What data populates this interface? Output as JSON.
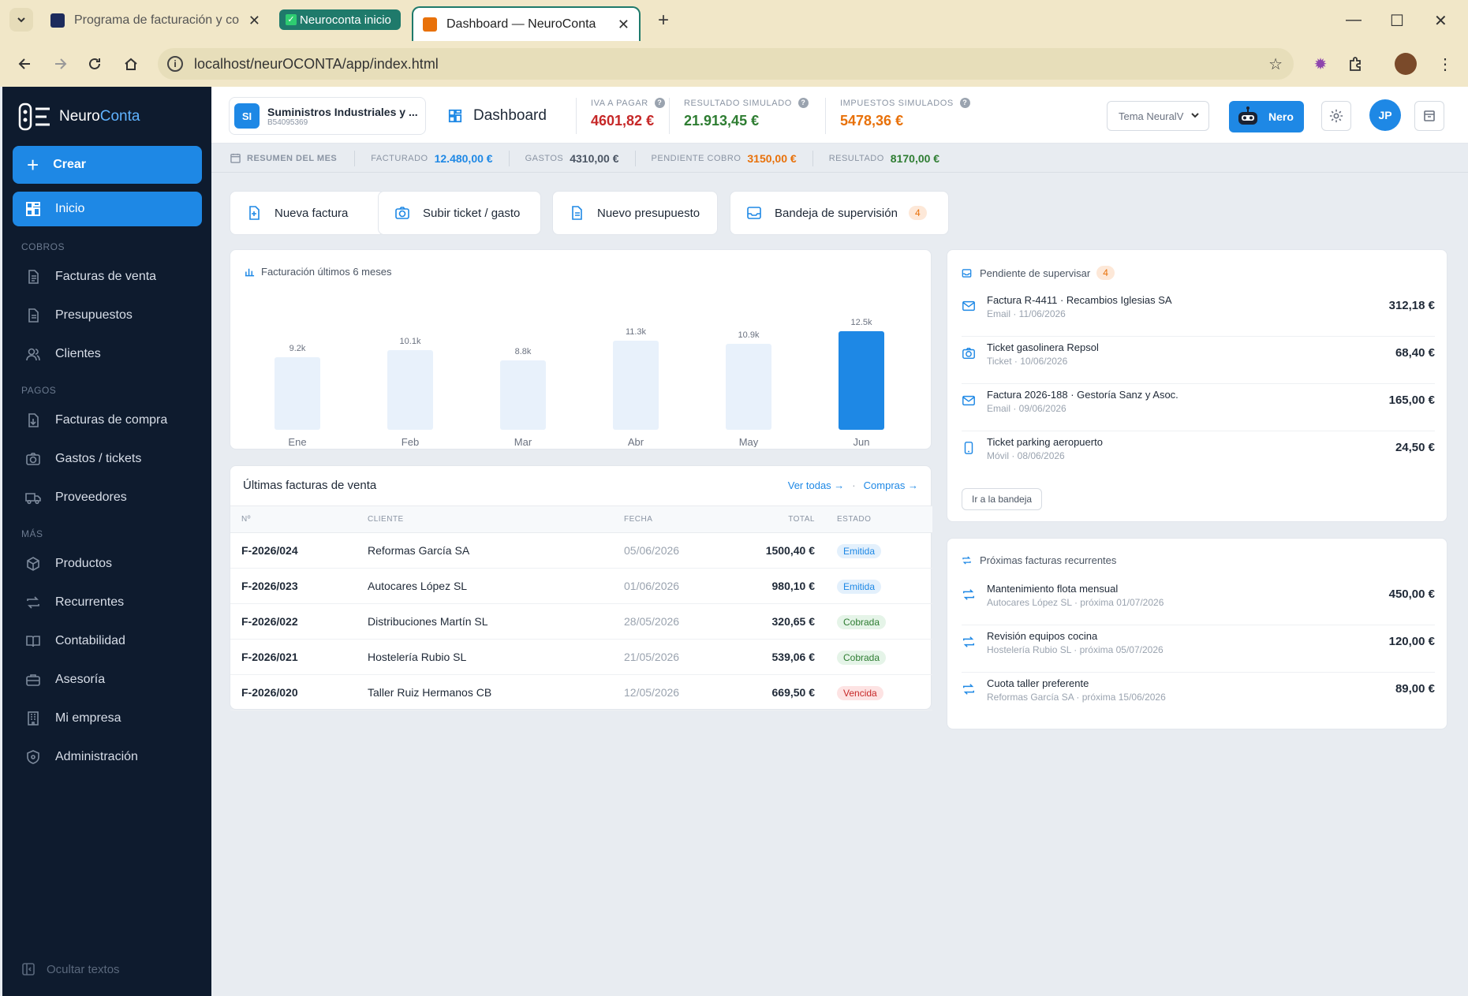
{
  "browser": {
    "tabs": [
      {
        "title": "Programa de facturación y cont"
      },
      {
        "title": "Neuroconta inicio"
      },
      {
        "title": "Dashboard — NeuroConta"
      }
    ],
    "url": "localhost/neurOCONTA/app/index.html"
  },
  "sidebar": {
    "brand_a": "Neuro",
    "brand_b": "Conta",
    "create_label": "Crear",
    "home_label": "Inicio",
    "sections": {
      "cobros": "COBROS",
      "pagos": "PAGOS",
      "mas": "MÁS"
    },
    "items": {
      "facturas_venta": "Facturas de venta",
      "presupuestos": "Presupuestos",
      "clientes": "Clientes",
      "facturas_compra": "Facturas de compra",
      "gastos": "Gastos / tickets",
      "proveedores": "Proveedores",
      "productos": "Productos",
      "recurrentes": "Recurrentes",
      "contabilidad": "Contabilidad",
      "asesoria": "Asesoría",
      "mi_empresa": "Mi empresa",
      "administracion": "Administración"
    },
    "hide_texts": "Ocultar textos"
  },
  "topbar": {
    "company_initials": "SI",
    "company_name": "Suministros Industriales y ...",
    "company_nif": "B54095369",
    "page_title": "Dashboard",
    "kpis": {
      "iva": {
        "label": "IVA A PAGAR",
        "value": "4601,82 €",
        "color": "#c62828"
      },
      "resultado": {
        "label": "RESULTADO SIMULADO",
        "value": "21.913,45 €",
        "color": "#2e7d32"
      },
      "impuestos": {
        "label": "IMPUESTOS SIMULADOS",
        "value": "5478,36 €",
        "color": "#e8710a"
      }
    },
    "theme": "Tema NeuralV",
    "nero_label": "Nero",
    "user_initials": "JP"
  },
  "summary": {
    "label": "RESUMEN DEL MES",
    "facturado_label": "FACTURADO",
    "facturado_value": "12.480,00 €",
    "gastos_label": "GASTOS",
    "gastos_value": "4310,00 €",
    "pendiente_label": "PENDIENTE COBRO",
    "pendiente_value": "3150,00 €",
    "resultado_label": "RESULTADO",
    "resultado_value": "8170,00 €"
  },
  "quick_actions": {
    "nueva_factura": "Nueva factura",
    "subir_ticket": "Subir ticket / gasto",
    "nuevo_presupuesto": "Nuevo presupuesto",
    "bandeja": "Bandeja de supervisión",
    "bandeja_count": "4"
  },
  "chart_data": {
    "type": "bar",
    "title": "Facturación últimos 6 meses",
    "categories": [
      "Ene",
      "Feb",
      "Mar",
      "Abr",
      "May",
      "Jun"
    ],
    "values": [
      9.2,
      10.1,
      8.8,
      11.3,
      10.9,
      12.5
    ],
    "data_labels": [
      "9.2k",
      "10.1k",
      "8.8k",
      "11.3k",
      "10.9k",
      "12.5k"
    ],
    "highlight_index": 5,
    "bar_color": "#e8f1fb",
    "highlight_color": "#1e88e5"
  },
  "invoices": {
    "title": "Últimas facturas de venta",
    "link_all": "Ver todas →",
    "link_dot": "·",
    "link_compras": "Compras →",
    "columns": [
      "Nº",
      "CLIENTE",
      "FECHA",
      "TOTAL",
      "ESTADO"
    ],
    "rows": [
      {
        "num": "F-2026/024",
        "client": "Reformas García SA",
        "date": "05/06/2026",
        "total": "1500,40 €",
        "status": "Emitida"
      },
      {
        "num": "F-2026/023",
        "client": "Autocares López SL",
        "date": "01/06/2026",
        "total": "980,10 €",
        "status": "Emitida"
      },
      {
        "num": "F-2026/022",
        "client": "Distribuciones Martín SL",
        "date": "28/05/2026",
        "total": "320,65 €",
        "status": "Cobrada"
      },
      {
        "num": "F-2026/021",
        "client": "Hostelería Rubio SL",
        "date": "21/05/2026",
        "total": "539,06 €",
        "status": "Cobrada"
      },
      {
        "num": "F-2026/020",
        "client": "Taller Ruiz Hermanos CB",
        "date": "12/05/2026",
        "total": "669,50 €",
        "status": "Vencida"
      }
    ]
  },
  "supervision": {
    "title": "Pendiente de supervisar",
    "count": "4",
    "items": [
      {
        "icon": "mail-icon",
        "title": "Factura R-4411 · Recambios Iglesias SA",
        "sub": "Email · 11/06/2026",
        "amount": "312,18 €"
      },
      {
        "icon": "camera-icon",
        "title": "Ticket gasolinera Repsol",
        "sub": "Ticket · 10/06/2026",
        "amount": "68,40 €"
      },
      {
        "icon": "mail-icon",
        "title": "Factura 2026-188 · Gestoría Sanz y Asoc.",
        "sub": "Email · 09/06/2026",
        "amount": "165,00 €"
      },
      {
        "icon": "phone-icon",
        "title": "Ticket parking aeropuerto",
        "sub": "Móvil · 08/06/2026",
        "amount": "24,50 €"
      }
    ],
    "button": "Ir a la bandeja"
  },
  "recurrent": {
    "title": "Próximas facturas recurrentes",
    "items": [
      {
        "title": "Mantenimiento flota mensual",
        "sub": "Autocares López SL · próxima 01/07/2026",
        "amount": "450,00 €"
      },
      {
        "title": "Revisión equipos cocina",
        "sub": "Hostelería Rubio SL · próxima 05/07/2026",
        "amount": "120,00 €"
      },
      {
        "title": "Cuota taller preferente",
        "sub": "Reformas García SA · próxima 15/06/2026",
        "amount": "89,00 €"
      }
    ]
  }
}
